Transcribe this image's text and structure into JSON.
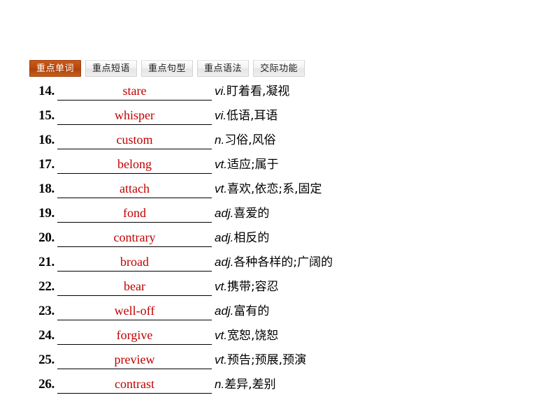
{
  "tabs": [
    {
      "label": "重点单词",
      "active": true
    },
    {
      "label": "重点短语",
      "active": false
    },
    {
      "label": "重点句型",
      "active": false
    },
    {
      "label": "重点语法",
      "active": false
    },
    {
      "label": "交际功能",
      "active": false
    }
  ],
  "colors": {
    "active_tab_bg": "#b8490f",
    "active_tab_text": "#ffffff",
    "inactive_tab_bg": "#f0f0f0",
    "inactive_tab_text": "#231f20",
    "answer_word": "#c00000",
    "page_bg": "#ffffff"
  },
  "word_list": [
    {
      "index": "14.",
      "word": "stare",
      "pos": "vi.",
      "meaning": "盯着看,凝视"
    },
    {
      "index": "15.",
      "word": "whisper",
      "pos": "vi.",
      "meaning": "低语,耳语"
    },
    {
      "index": "16.",
      "word": "custom",
      "pos": "n.",
      "meaning": "习俗,风俗"
    },
    {
      "index": "17.",
      "word": "belong",
      "pos": "vt.",
      "meaning": "适应;属于"
    },
    {
      "index": "18.",
      "word": "attach",
      "pos": "vt.",
      "meaning": "喜欢,依恋;系,固定"
    },
    {
      "index": "19.",
      "word": "fond",
      "pos": "adj.",
      "meaning": "喜爱的"
    },
    {
      "index": "20.",
      "word": "contrary",
      "pos": "adj.",
      "meaning": "相反的"
    },
    {
      "index": "21.",
      "word": "broad",
      "pos": "adj.",
      "meaning": "各种各样的;广阔的"
    },
    {
      "index": "22.",
      "word": "bear",
      "pos": "vt.",
      "meaning": "携带;容忍"
    },
    {
      "index": "23.",
      "word": "well-off",
      "pos": "adj.",
      "meaning": "富有的"
    },
    {
      "index": "24.",
      "word": "forgive",
      "pos": "vt.",
      "meaning": "宽恕,饶恕"
    },
    {
      "index": "25.",
      "word": "preview",
      "pos": "vt.",
      "meaning": "预告;预展,预演"
    },
    {
      "index": "26.",
      "word": "contrast",
      "pos": "n.",
      "meaning": "差异,差别"
    }
  ]
}
